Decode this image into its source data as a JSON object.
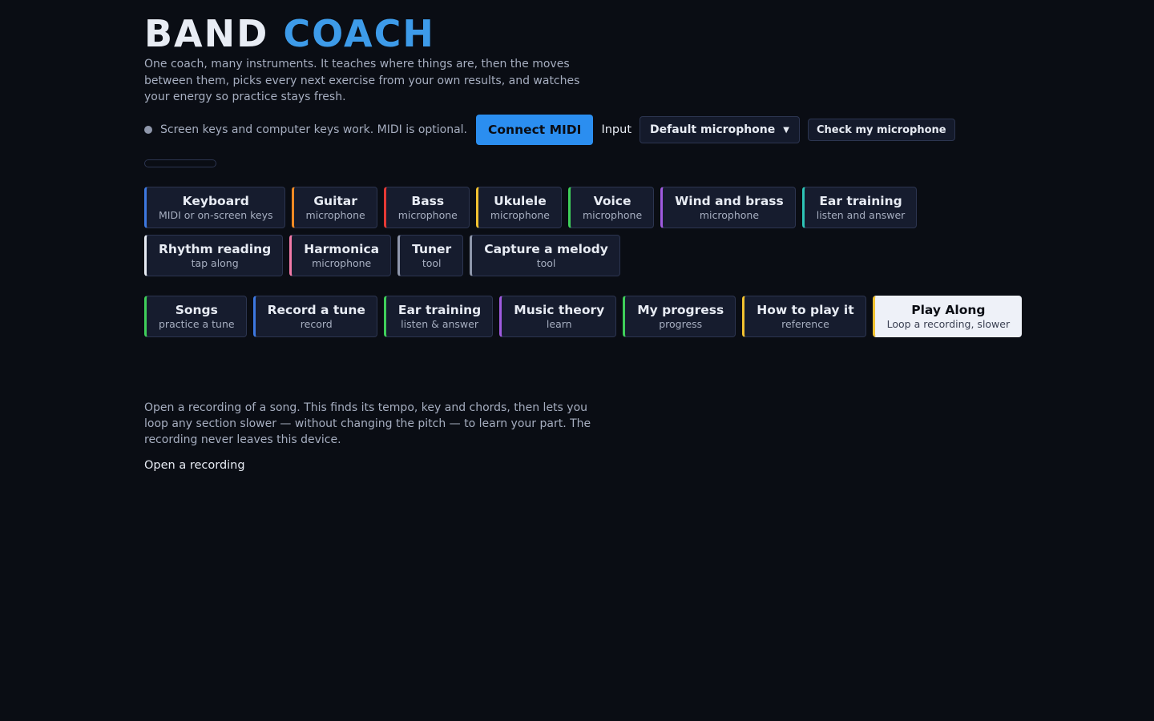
{
  "header": {
    "title_word1": "BAND",
    "title_word2": "COACH",
    "intro": "One coach, many instruments. It teaches where things are, then the moves between them, picks every next exercise from your own results, and watches your energy so practice stays fresh."
  },
  "status": {
    "text": "Screen keys and computer keys work. MIDI is optional.",
    "connect_label": "Connect MIDI",
    "input_label": "Input",
    "input_selected": "Default microphone",
    "check_label": "Check my microphone",
    "level_fraction": 0
  },
  "instruments": [
    {
      "name": "Keyboard",
      "sub": "MIDI or on-screen keys",
      "color": "#3d78e0"
    },
    {
      "name": "Guitar",
      "sub": "microphone",
      "color": "#f08a24"
    },
    {
      "name": "Bass",
      "sub": "microphone",
      "color": "#e53935"
    },
    {
      "name": "Ukulele",
      "sub": "microphone",
      "color": "#f2c230"
    },
    {
      "name": "Voice",
      "sub": "microphone",
      "color": "#3fcf5a"
    },
    {
      "name": "Wind and brass",
      "sub": "microphone",
      "color": "#a05be0"
    },
    {
      "name": "Ear training",
      "sub": "listen and answer",
      "color": "#2ec4b6"
    },
    {
      "name": "Rhythm reading",
      "sub": "tap along",
      "color": "#e8ecf4"
    },
    {
      "name": "Harmonica",
      "sub": "microphone",
      "color": "#f27aa8"
    },
    {
      "name": "Tuner",
      "sub": "tool",
      "color": "#8f97ab"
    },
    {
      "name": "Capture a melody",
      "sub": "tool",
      "color": "#8f97ab"
    }
  ],
  "sections": [
    {
      "name": "Songs",
      "sub": "practice a tune",
      "color": "#3fcf5a"
    },
    {
      "name": "Record a tune",
      "sub": "record",
      "color": "#3d78e0"
    },
    {
      "name": "Ear training",
      "sub": "listen & answer",
      "color": "#3fcf5a"
    },
    {
      "name": "Music theory",
      "sub": "learn",
      "color": "#a05be0"
    },
    {
      "name": "My progress",
      "sub": "progress",
      "color": "#3fcf5a"
    },
    {
      "name": "How to play it",
      "sub": "reference",
      "color": "#f2c230"
    },
    {
      "name": "Play Along",
      "sub": "Loop a recording, slower",
      "color": "#f2c230",
      "active": true
    }
  ],
  "playalong": {
    "description": "Open a recording of a song. This finds its tempo, key and chords, then lets you loop any section slower — without changing the pitch — to learn your part. The recording never leaves this device.",
    "open_label": "Open a recording"
  }
}
